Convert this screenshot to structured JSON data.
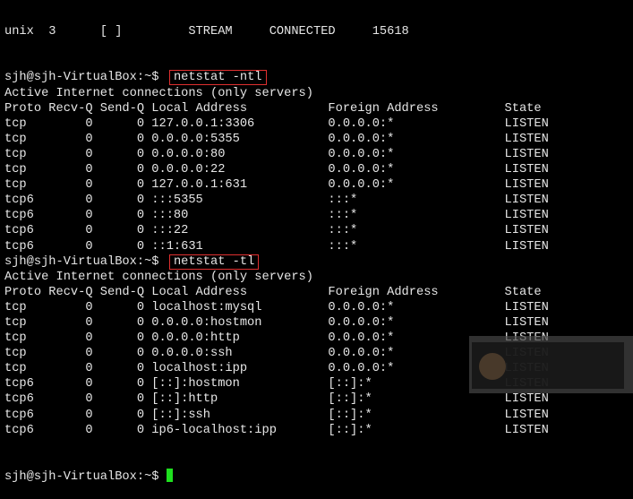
{
  "top_partial_line": "unix  3      [ ]         STREAM     CONNECTED     15618",
  "prompt": "sjh@sjh-VirtualBox:~$ ",
  "blocks": [
    {
      "command": "netstat -ntl",
      "title": "Active Internet connections (only servers)",
      "header": "Proto Recv-Q Send-Q Local Address           Foreign Address         State",
      "rows": [
        [
          "tcp",
          "0",
          "0",
          "127.0.0.1:3306",
          "0.0.0.0:*",
          "LISTEN"
        ],
        [
          "tcp",
          "0",
          "0",
          "0.0.0.0:5355",
          "0.0.0.0:*",
          "LISTEN"
        ],
        [
          "tcp",
          "0",
          "0",
          "0.0.0.0:80",
          "0.0.0.0:*",
          "LISTEN"
        ],
        [
          "tcp",
          "0",
          "0",
          "0.0.0.0:22",
          "0.0.0.0:*",
          "LISTEN"
        ],
        [
          "tcp",
          "0",
          "0",
          "127.0.0.1:631",
          "0.0.0.0:*",
          "LISTEN"
        ],
        [
          "tcp6",
          "0",
          "0",
          ":::5355",
          ":::*",
          "LISTEN"
        ],
        [
          "tcp6",
          "0",
          "0",
          ":::80",
          ":::*",
          "LISTEN"
        ],
        [
          "tcp6",
          "0",
          "0",
          ":::22",
          ":::*",
          "LISTEN"
        ],
        [
          "tcp6",
          "0",
          "0",
          "::1:631",
          ":::*",
          "LISTEN"
        ]
      ]
    },
    {
      "command": "netstat -tl",
      "title": "Active Internet connections (only servers)",
      "header": "Proto Recv-Q Send-Q Local Address           Foreign Address         State",
      "rows": [
        [
          "tcp",
          "0",
          "0",
          "localhost:mysql",
          "0.0.0.0:*",
          "LISTEN"
        ],
        [
          "tcp",
          "0",
          "0",
          "0.0.0.0:hostmon",
          "0.0.0.0:*",
          "LISTEN"
        ],
        [
          "tcp",
          "0",
          "0",
          "0.0.0.0:http",
          "0.0.0.0:*",
          "LISTEN"
        ],
        [
          "tcp",
          "0",
          "0",
          "0.0.0.0:ssh",
          "0.0.0.0:*",
          "LISTEN"
        ],
        [
          "tcp",
          "0",
          "0",
          "localhost:ipp",
          "0.0.0.0:*",
          "LISTEN"
        ],
        [
          "tcp6",
          "0",
          "0",
          "[::]:hostmon",
          "[::]:*",
          "LISTEN"
        ],
        [
          "tcp6",
          "0",
          "0",
          "[::]:http",
          "[::]:*",
          "LISTEN"
        ],
        [
          "tcp6",
          "0",
          "0",
          "[::]:ssh",
          "[::]:*",
          "LISTEN"
        ],
        [
          "tcp6",
          "0",
          "0",
          "ip6-localhost:ipp",
          "[::]:*",
          "LISTEN"
        ]
      ]
    }
  ],
  "colors": {
    "cursor": "#1ee01e",
    "highlight_box": "#e03030",
    "text": "#e6e6e6"
  }
}
